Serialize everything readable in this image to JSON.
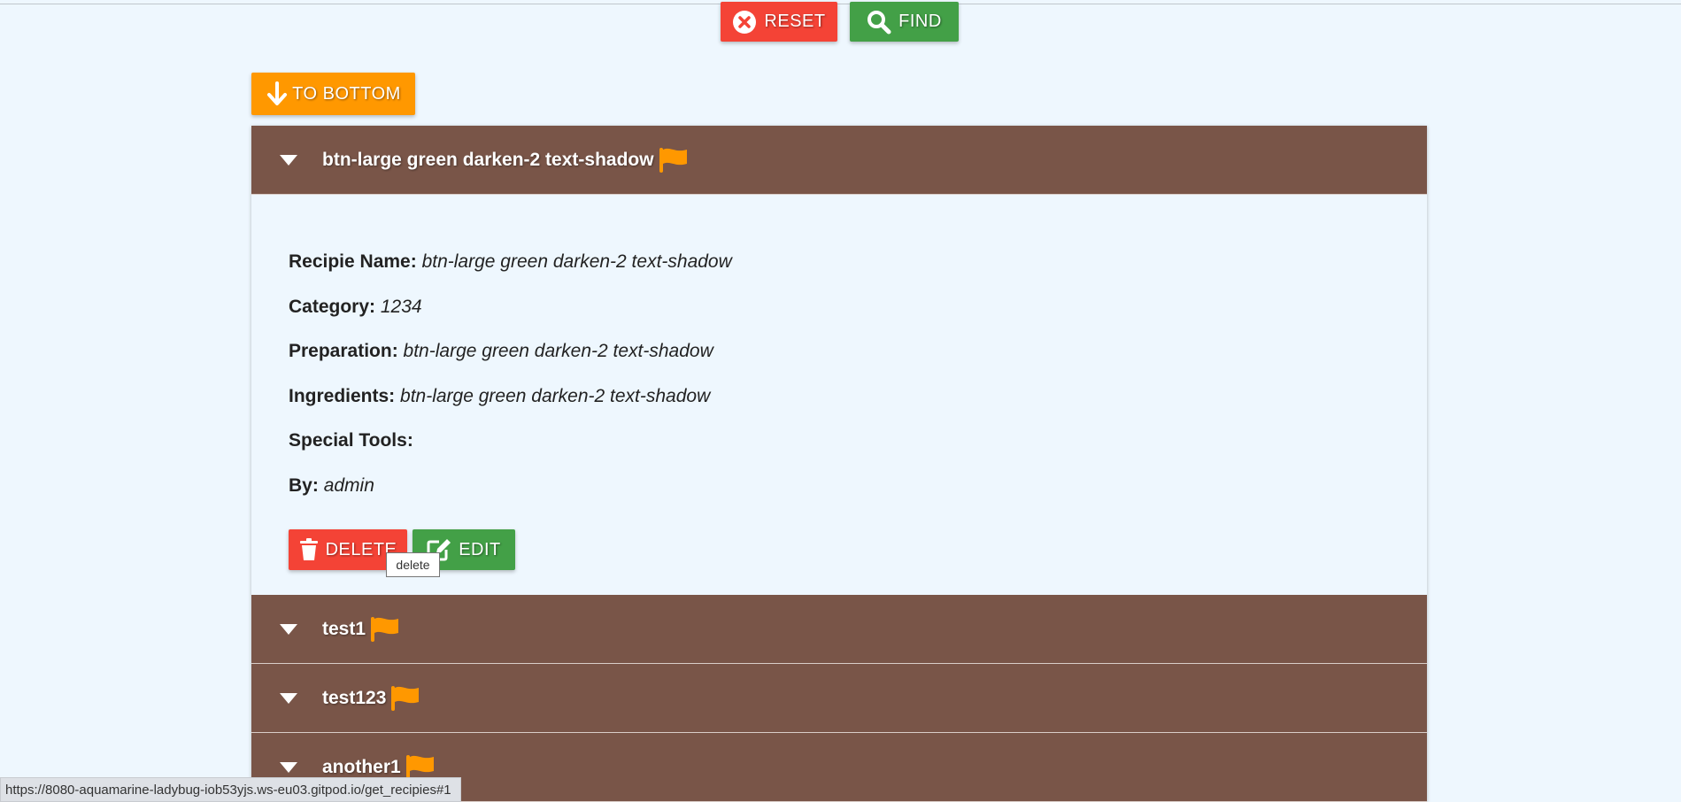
{
  "toolbar": {
    "reset_label": "RESET",
    "find_label": "FIND",
    "to_bottom_label": "TO BOTTOM"
  },
  "colors": {
    "background": "#eef7fe",
    "header": "#795548",
    "reset": "#f44336",
    "find": "#43a047",
    "to_bottom": "#ff9800",
    "flag": "#ff9800"
  },
  "recipes": [
    {
      "title": "btn-large green darken-2 text-shadow",
      "expanded": true,
      "details": {
        "name_label": "Recipie Name:",
        "name": "btn-large green darken-2 text-shadow",
        "category_label": "Category:",
        "category": "1234",
        "preparation_label": "Preparation:",
        "preparation": "btn-large green darken-2 text-shadow",
        "ingredients_label": "Ingredients:",
        "ingredients": "btn-large green darken-2 text-shadow",
        "tools_label": "Special Tools:",
        "tools": "",
        "by_label": "By:",
        "by": "admin"
      },
      "delete_label": "DELETE",
      "edit_label": "EDIT"
    },
    {
      "title": "test1",
      "expanded": false
    },
    {
      "title": "test123",
      "expanded": false
    },
    {
      "title": "another1",
      "expanded": false
    }
  ],
  "tooltip": "delete",
  "status_url": "https://8080-aquamarine-ladybug-iob53yjs.ws-eu03.gitpod.io/get_recipies#1",
  "icons": [
    "cancel-circle-icon",
    "search-icon",
    "arrow-down-icon",
    "caret-down-icon",
    "flag-icon",
    "trash-icon",
    "edit-icon"
  ]
}
